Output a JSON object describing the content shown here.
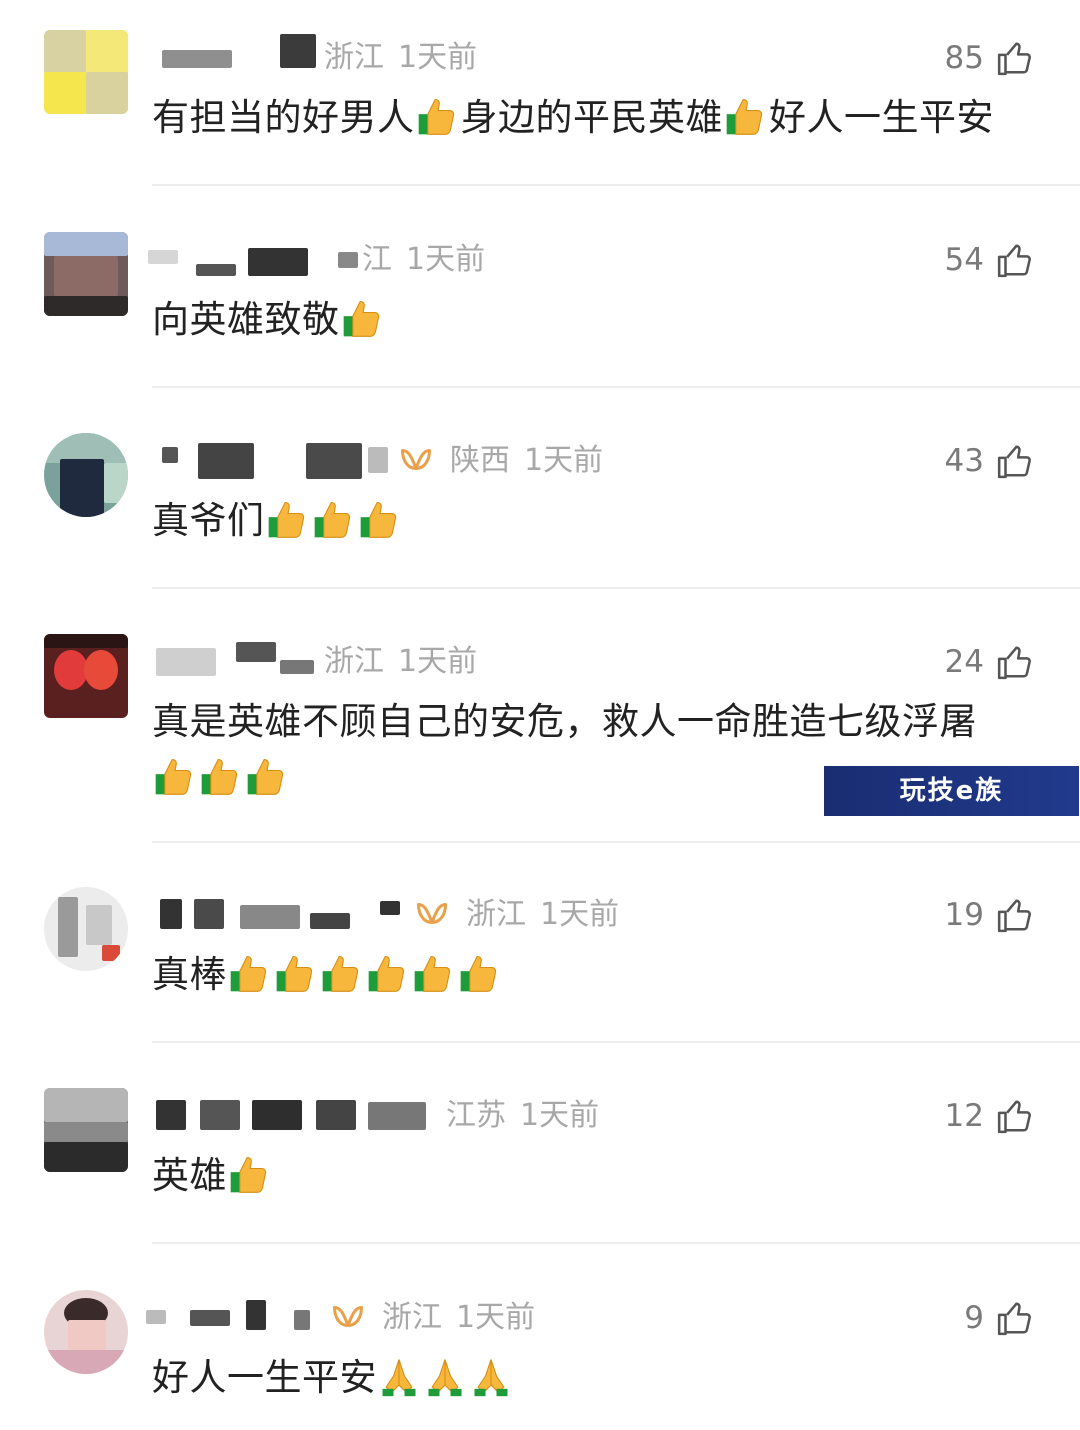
{
  "comments": [
    {
      "location": "浙江",
      "time": "1天前",
      "likes": "85",
      "text": "有担当的好男人",
      "text2": "身边的平民英雄",
      "text3": "好人一生平安",
      "emoji": "thumbs-up"
    },
    {
      "location": "江",
      "time": "1天前",
      "likes": "54",
      "text": "向英雄致敬",
      "emoji": "thumbs-up"
    },
    {
      "location": "陕西",
      "time": "1天前",
      "likes": "43",
      "text": "真爷们",
      "emoji": "thumbs-up"
    },
    {
      "location": "浙江",
      "time": "1天前",
      "likes": "24",
      "text": "真是英雄不顾自己的安危，救人一命胜造七级浮屠",
      "emoji": "thumbs-up"
    },
    {
      "location": "浙江",
      "time": "1天前",
      "likes": "19",
      "text": "真棒",
      "emoji": "thumbs-up"
    },
    {
      "location": "江苏",
      "time": "1天前",
      "likes": "12",
      "text": "英雄",
      "emoji": "thumbs-up"
    },
    {
      "location": "浙江",
      "time": "1天前",
      "likes": "9",
      "text": "好人一生平安",
      "emoji": "folded-hands"
    }
  ],
  "watermark": "玩技e族",
  "colors": {
    "meta": "#a8a8a8",
    "vip": "#e9a04a",
    "text": "#222222",
    "divider": "#ececec"
  }
}
